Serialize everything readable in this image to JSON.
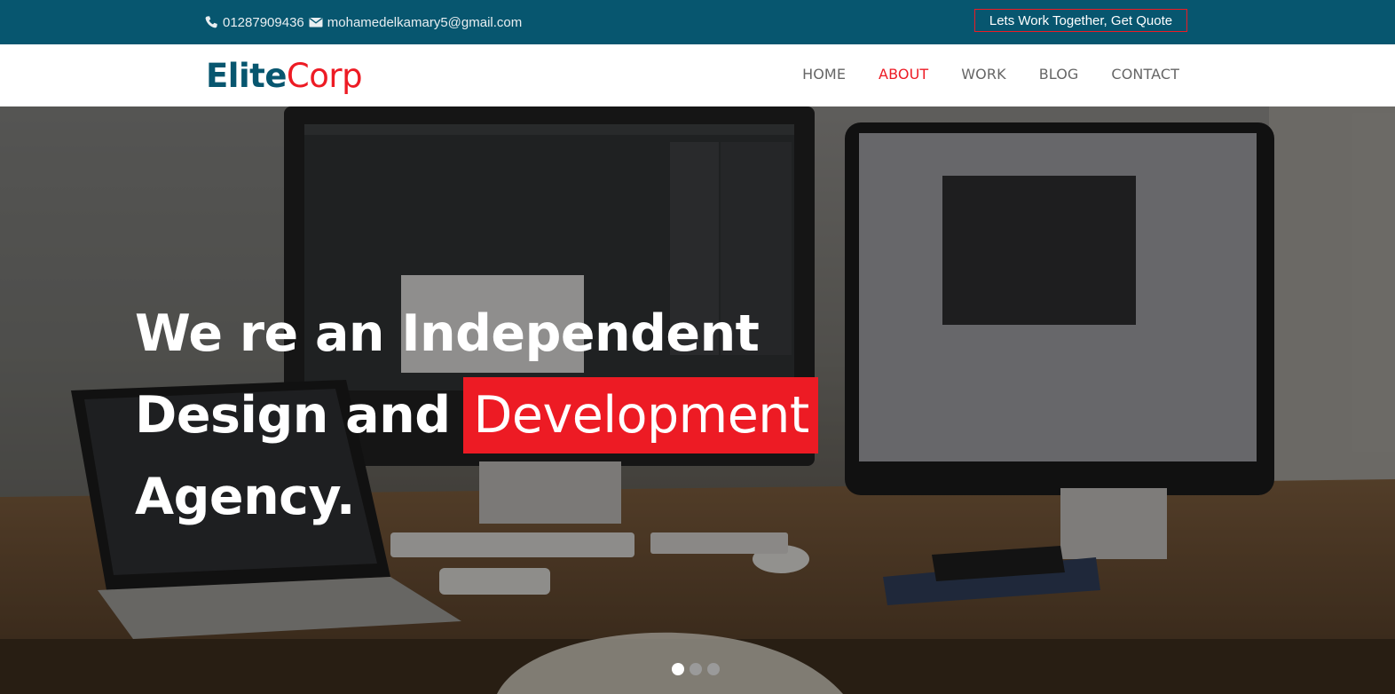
{
  "topbar": {
    "phone": "01287909436",
    "email": "mohamedelkamary5@gmail.com",
    "quote_button": "Lets Work Together, Get Quote"
  },
  "logo": {
    "part1": "Elite",
    "part2": "Corp"
  },
  "nav": {
    "items": [
      {
        "label": "HOME"
      },
      {
        "label": "ABOUT",
        "active": true
      },
      {
        "label": "WORK"
      },
      {
        "label": "BLOG"
      },
      {
        "label": "CONTACT"
      }
    ]
  },
  "hero": {
    "line1": "We re an Independent",
    "line2_prefix": "Design and",
    "line2_highlight": "Development",
    "line3": "Agency.",
    "slides": {
      "count": 3,
      "active": 1
    }
  },
  "colors": {
    "topbar": "#07566f",
    "accent": "#ed1b24",
    "nav_text": "#666666"
  },
  "icons": {
    "phone": "phone-icon",
    "email": "envelope-icon"
  }
}
